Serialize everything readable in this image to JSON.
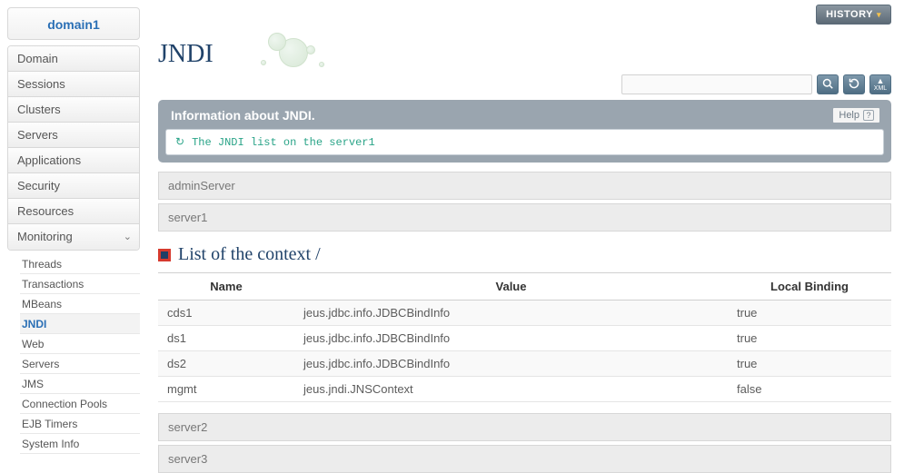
{
  "domain": "domain1",
  "nav": {
    "items": [
      "Domain",
      "Sessions",
      "Clusters",
      "Servers",
      "Applications",
      "Security",
      "Resources",
      "Monitoring"
    ],
    "expanded": "Monitoring",
    "sub": [
      "Threads",
      "Transactions",
      "MBeans",
      "JNDI",
      "Web",
      "Servers",
      "JMS",
      "Connection Pools",
      "EJB Timers",
      "System Info"
    ],
    "active_sub": "JNDI"
  },
  "history_label": "HISTORY",
  "page_title": "JNDI",
  "search_placeholder": "",
  "panel": {
    "title": "Information about JNDI.",
    "help_label": "Help",
    "message": "The JNDI list on the server1"
  },
  "servers_before": [
    "adminServer",
    "server1"
  ],
  "section_title": "List of the context /",
  "table": {
    "headers": [
      "Name",
      "Value",
      "Local Binding"
    ],
    "rows": [
      {
        "name": "cds1",
        "value": "jeus.jdbc.info.JDBCBindInfo",
        "local": "true"
      },
      {
        "name": "ds1",
        "value": "jeus.jdbc.info.JDBCBindInfo",
        "local": "true"
      },
      {
        "name": "ds2",
        "value": "jeus.jdbc.info.JDBCBindInfo",
        "local": "true"
      },
      {
        "name": "mgmt",
        "value": "jeus.jndi.JNSContext",
        "local": "false"
      }
    ]
  },
  "servers_after": [
    "server2",
    "server3"
  ]
}
